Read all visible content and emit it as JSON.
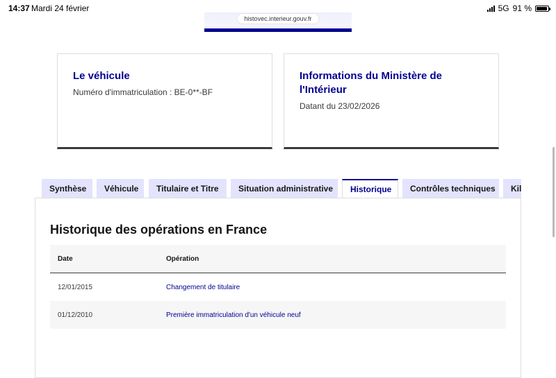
{
  "status_bar": {
    "time": "14:37",
    "date": "Mardi 24 février",
    "network": "5G",
    "battery": "91 %",
    "battery_level": 0.91
  },
  "browser": {
    "url": "histovec.interieur.gouv.fr"
  },
  "cards": [
    {
      "title": "Le véhicule",
      "text": "Numéro d'immatriculation : BE-0**-BF"
    },
    {
      "title": "Informations du Ministère de l'Intérieur",
      "text": "Datant du 23/02/2026"
    }
  ],
  "tabs": [
    {
      "label": "Synthèse",
      "active": false
    },
    {
      "label": "Véhicule",
      "active": false
    },
    {
      "label": "Titulaire et Titre",
      "active": false
    },
    {
      "label": "Situation administrative",
      "active": false
    },
    {
      "label": "Historique",
      "active": true
    },
    {
      "label": "Contrôles techniques",
      "active": false
    },
    {
      "label": "Kilo",
      "active": false
    }
  ],
  "history": {
    "title": "Historique des opérations en France",
    "columns": [
      "Date",
      "Opération"
    ],
    "rows": [
      {
        "date": "12/01/2015",
        "operation": "Changement de titulaire"
      },
      {
        "date": "01/12/2010",
        "operation": "Première immatriculation d'un véhicule neuf"
      }
    ]
  },
  "colors": {
    "accent": "#000091",
    "tab_background": "#e3e3fd"
  }
}
